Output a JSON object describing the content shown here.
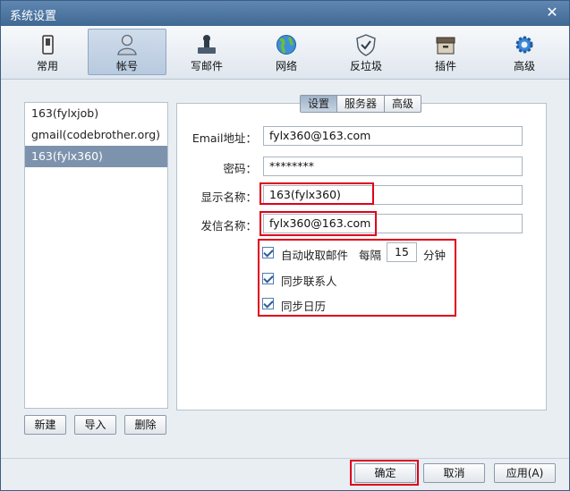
{
  "window": {
    "title": "系统设置",
    "close_glyph": "✕"
  },
  "toolbar": [
    {
      "label": "常用",
      "icon": "phone-icon"
    },
    {
      "label": "帐号",
      "icon": "user-icon"
    },
    {
      "label": "写邮件",
      "icon": "stamp-icon"
    },
    {
      "label": "网络",
      "icon": "globe-icon"
    },
    {
      "label": "反垃圾",
      "icon": "shield-icon"
    },
    {
      "label": "插件",
      "icon": "box-icon"
    },
    {
      "label": "高级",
      "icon": "gear-icon"
    }
  ],
  "accounts": [
    "163(fylxjob)",
    "gmail(codebrother.org)",
    "163(fylx360)"
  ],
  "account_buttons": {
    "new": "新建",
    "import": "导入",
    "delete": "删除"
  },
  "tabs": [
    "设置",
    "服务器",
    "高级"
  ],
  "form": {
    "email_label": "Email地址：",
    "email_value": "fylx360@163.com",
    "password_label": "密码：",
    "password_value": "********",
    "display_label": "显示名称：",
    "display_value": "163(fylx360)",
    "sender_label": "发信名称：",
    "sender_value": "fylx360@163.com",
    "auto_receive": "自动收取邮件",
    "every": "每隔",
    "interval": "15",
    "minutes": "分钟",
    "sync_contacts": "同步联系人",
    "sync_calendar": "同步日历"
  },
  "footer": {
    "ok": "确定",
    "cancel": "取消",
    "apply": "应用(A)"
  },
  "colors": {
    "highlight": "#e0001a",
    "selected_row": "#7d93ad"
  }
}
